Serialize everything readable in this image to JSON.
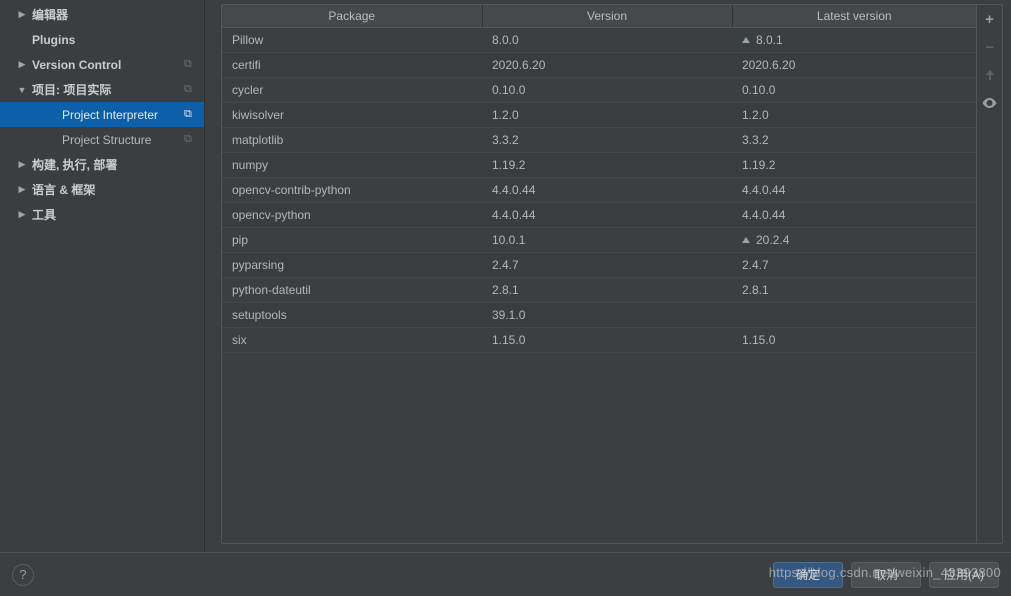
{
  "sidebar": {
    "items": [
      {
        "label": "编辑器",
        "arrow": "▶",
        "bold": true
      },
      {
        "label": "Plugins",
        "arrow": "",
        "bold": true
      },
      {
        "label": "Version Control",
        "arrow": "▶",
        "bold": true,
        "copy": true
      },
      {
        "label": "项目: 项目实际",
        "arrow": "▼",
        "bold": true,
        "copy": true
      },
      {
        "label": "Project Interpreter",
        "arrow": "",
        "child": true,
        "selected": true,
        "copy": true
      },
      {
        "label": "Project Structure",
        "arrow": "",
        "child": true,
        "copy": true
      },
      {
        "label": "构建, 执行, 部署",
        "arrow": "▶",
        "bold": true
      },
      {
        "label": "语言 & 框架",
        "arrow": "▶",
        "bold": true
      },
      {
        "label": "工具",
        "arrow": "▶",
        "bold": true
      }
    ]
  },
  "table": {
    "headers": {
      "package": "Package",
      "version": "Version",
      "latest": "Latest version"
    },
    "rows": [
      {
        "pkg": "Pillow",
        "ver": "8.0.0",
        "latest": "8.0.1",
        "update": true
      },
      {
        "pkg": "certifi",
        "ver": "2020.6.20",
        "latest": "2020.6.20"
      },
      {
        "pkg": "cycler",
        "ver": "0.10.0",
        "latest": "0.10.0"
      },
      {
        "pkg": "kiwisolver",
        "ver": "1.2.0",
        "latest": "1.2.0"
      },
      {
        "pkg": "matplotlib",
        "ver": "3.3.2",
        "latest": "3.3.2"
      },
      {
        "pkg": "numpy",
        "ver": "1.19.2",
        "latest": "1.19.2"
      },
      {
        "pkg": "opencv-contrib-python",
        "ver": "4.4.0.44",
        "latest": "4.4.0.44"
      },
      {
        "pkg": "opencv-python",
        "ver": "4.4.0.44",
        "latest": "4.4.0.44"
      },
      {
        "pkg": "pip",
        "ver": "10.0.1",
        "latest": "20.2.4",
        "update": true
      },
      {
        "pkg": "pyparsing",
        "ver": "2.4.7",
        "latest": "2.4.7"
      },
      {
        "pkg": "python-dateutil",
        "ver": "2.8.1",
        "latest": "2.8.1"
      },
      {
        "pkg": "setuptools",
        "ver": "39.1.0",
        "latest": ""
      },
      {
        "pkg": "six",
        "ver": "1.15.0",
        "latest": "1.15.0"
      }
    ]
  },
  "buttons": {
    "ok": "确定",
    "cancel": "取消",
    "apply": "应用(A)"
  },
  "watermark": "https://blog.csdn.net/weixin_43393800"
}
